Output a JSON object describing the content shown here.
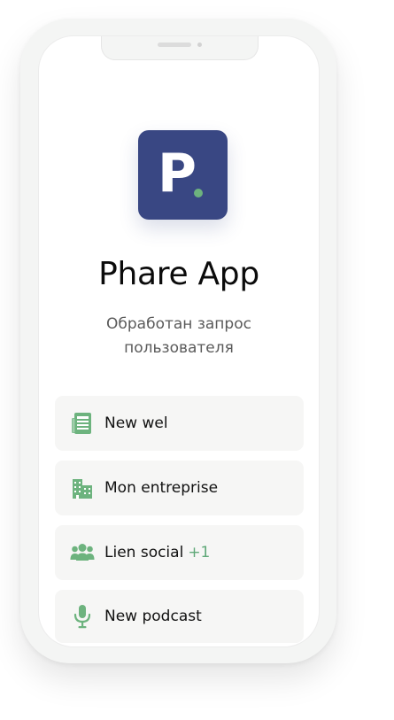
{
  "app": {
    "name": "Phare App",
    "logo_letter": "P",
    "subtitle_line1": "Обработан запрос",
    "subtitle_line2": "пользователя"
  },
  "colors": {
    "brand": "#394783",
    "accent": "#6db37e"
  },
  "menu": {
    "items": [
      {
        "label": "New wel",
        "icon": "newspaper-icon"
      },
      {
        "label": "Mon entreprise",
        "icon": "building-icon"
      },
      {
        "label": "Lien social",
        "icon": "users-icon",
        "badge": "+1"
      },
      {
        "label": "New podcast",
        "icon": "microphone-icon"
      }
    ]
  }
}
